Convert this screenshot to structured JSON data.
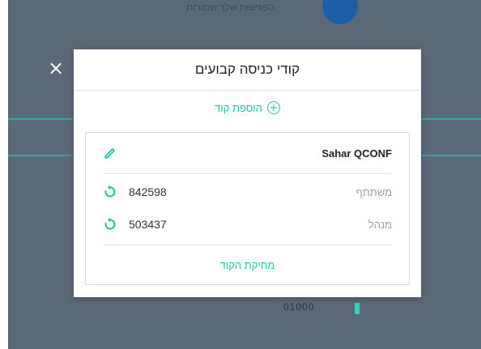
{
  "background": {
    "title": "הפגישות שלך שמורות",
    "code": "01000"
  },
  "modal": {
    "title": "קודי כניסה קבועים",
    "add_label": "הוספת קוד",
    "close_icon": "×",
    "conference": {
      "name": "Sahar QCONF",
      "participant_label": "משתתף",
      "participant_code": "842598",
      "moderator_label": "מנהל",
      "moderator_code": "503437",
      "delete_label": "מחיקת הקוד"
    }
  },
  "colors": {
    "accent": "#22c2a7",
    "overlay": "#5a6878"
  },
  "icons": {
    "add": "plus-circle-icon",
    "edit": "pencil-icon",
    "refresh": "refresh-icon",
    "close": "close-icon"
  }
}
